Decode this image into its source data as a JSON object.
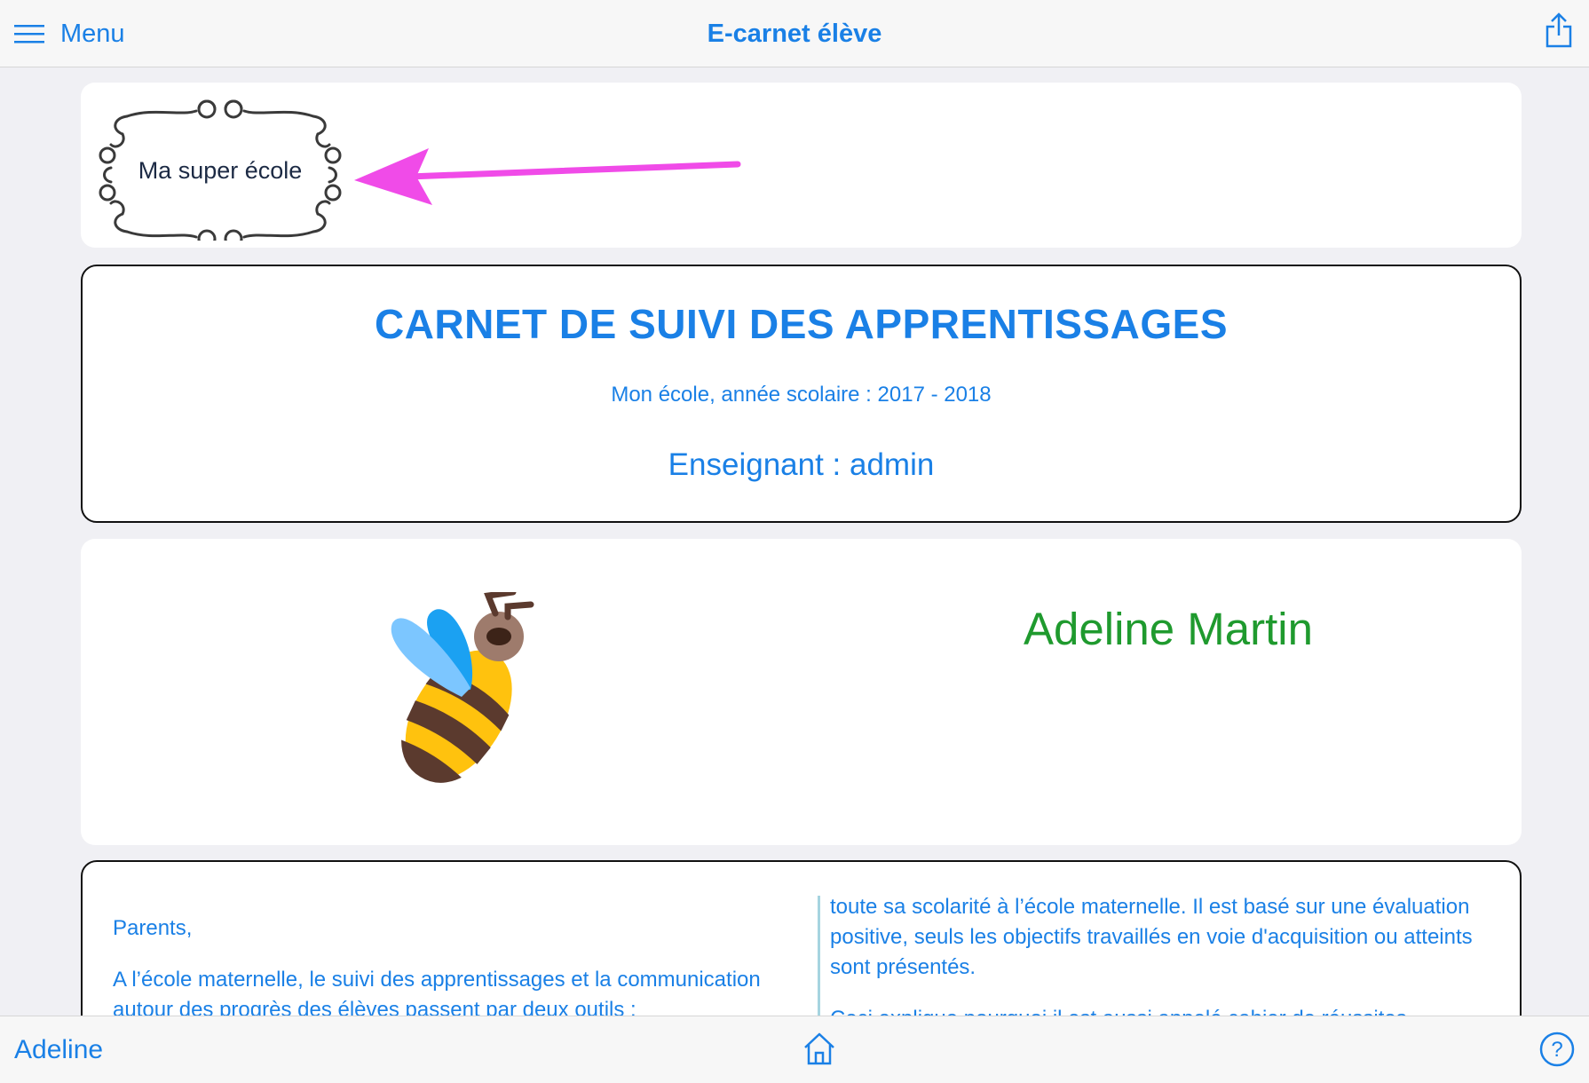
{
  "topbar": {
    "menu_label": "Menu",
    "title": "E-carnet élève"
  },
  "logo": {
    "text": "Ma super école"
  },
  "title_card": {
    "title": "CARNET DE SUIVI DES APPRENTISSAGES",
    "school_year": "Mon école, année scolaire : 2017 - 2018",
    "teacher": "Enseignant : admin"
  },
  "student": {
    "name": "Adeline Martin",
    "avatar_icon": "bee-icon"
  },
  "intro_text": {
    "left": [
      "Parents,",
      "A l’école maternelle, le suivi des apprentissages et la communication autour des progrès des élèves passent par deux outils :"
    ],
    "right": [
      "toute sa scolarité à l’école maternelle. Il est basé sur une évaluation positive, seuls les objectifs travaillés en voie d'acquisition ou atteints sont présentés.",
      "Ceci explique pourquoi il est aussi appelé cahier de réussites"
    ]
  },
  "bottombar": {
    "user_label": "Adeline"
  },
  "colors": {
    "accent_blue": "#1a80e6",
    "name_green": "#1f9a2e",
    "arrow_magenta": "#f04be8",
    "background": "#f0f0f4"
  }
}
